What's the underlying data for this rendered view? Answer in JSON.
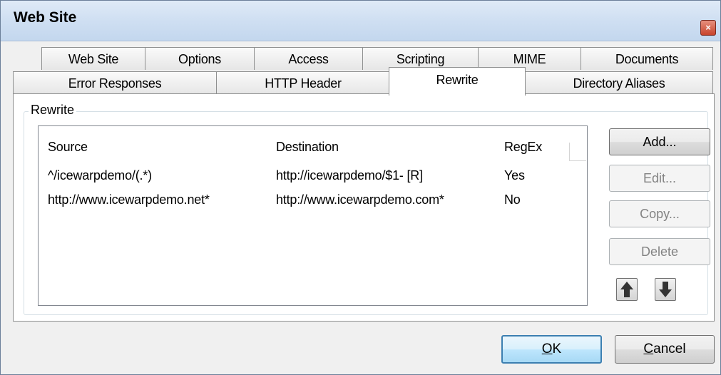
{
  "window": {
    "title": "Web Site",
    "close_glyph": "×"
  },
  "tabs": {
    "row1": [
      "Web Site",
      "Options",
      "Access",
      "Scripting",
      "MIME",
      "Documents"
    ],
    "row2": [
      "Error Responses",
      "HTTP Header",
      "Rewrite",
      "Directory Aliases"
    ],
    "active": "Rewrite"
  },
  "group": {
    "label": "Rewrite"
  },
  "list": {
    "columns": [
      "Source",
      "Destination",
      "RegEx"
    ],
    "rows": [
      [
        "^/icewarpdemo/(.*)",
        "http://icewarpdemo/$1- [R]",
        "Yes"
      ],
      [
        "http://www.icewarpdemo.net*",
        "http://www.icewarpdemo.com*",
        "No"
      ]
    ]
  },
  "buttons": {
    "add": "Add...",
    "edit": "Edit...",
    "copy": "Copy...",
    "delete": "Delete",
    "move_up_icon": "arrow-up-icon",
    "move_down_icon": "arrow-down-icon"
  },
  "footer": {
    "ok_first": "O",
    "ok_rest": "K",
    "cancel_first": "C",
    "cancel_rest": "ancel"
  }
}
